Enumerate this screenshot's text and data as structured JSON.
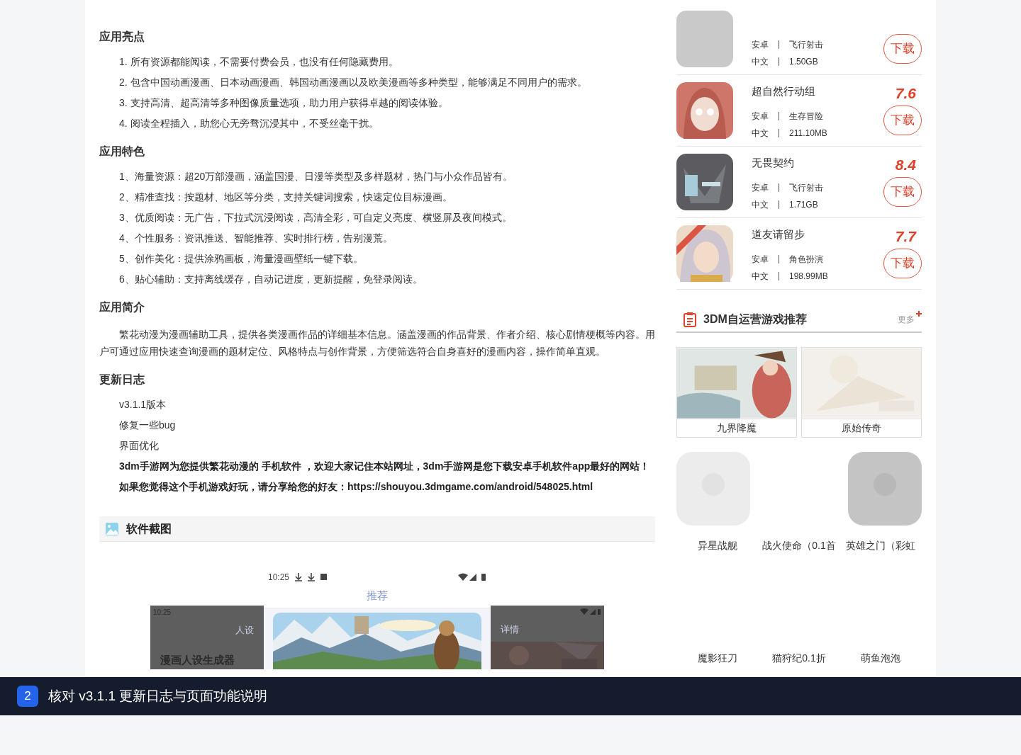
{
  "highlights": {
    "heading": "应用亮点",
    "items": [
      "1. 所有资源都能阅读，不需要付费会员，也没有任何隐藏费用。",
      "2. 包含中国动画漫画、日本动画漫画、韩国动画漫画以及欧美漫画等多种类型，能够满足不同用户的需求。",
      "3. 支持高清、超高清等多种图像质量选项，助力用户获得卓越的阅读体验。",
      "4. 阅读全程插入，助您心无旁骛沉浸其中，不受丝毫干扰。"
    ]
  },
  "features": {
    "heading": "应用特色",
    "items": [
      "1、海量资源：超20万部漫画，涵盖国漫、日漫等类型及多样题材，热门与小众作品皆有。",
      "2、精准查找：按题材、地区等分类，支持关键词搜索，快速定位目标漫画。",
      "3、优质阅读：无广告，下拉式沉浸阅读，高清全彩，可自定义亮度、横竖屏及夜间模式。",
      "4、个性服务：资讯推送、智能推荐、实时排行榜，告别漫荒。",
      "5、创作美化：提供涂鸦画板，海量漫画壁纸一键下载。",
      "6、贴心辅助：支持离线缓存，自动记进度，更新提醒，免登录阅读。"
    ]
  },
  "intro": {
    "heading": "应用简介",
    "text": "繁花动漫为漫画辅助工具，提供各类漫画作品的详细基本信息。涵盖漫画的作品背景、作者介绍、核心剧情梗概等内容。用户可通过应用快速查询漫画的题材定位、风格特点与创作背景，方便筛选符合自身喜好的漫画内容，操作简单直观。"
  },
  "changelog": {
    "heading": "更新日志",
    "lines": [
      "v3.1.1版本",
      "修复一些bug",
      "界面优化"
    ],
    "notes": [
      "3dm手游网为您提供繁花动漫的 手机软件 ，欢迎大家记住本站网址，3dm手游网是您下载安卓手机软件app最好的网站！",
      "如果您觉得这个手机游戏好玩，请分享给您的好友：https://shouyou.3dmgame.com/android/548025.html"
    ]
  },
  "screenshots": {
    "heading": "软件截图",
    "phones": [
      {
        "kind": "side",
        "time": "10:25",
        "title": "人设",
        "card": "漫画人设生成器"
      },
      {
        "kind": "main",
        "time": "10:25",
        "title": "推荐"
      },
      {
        "kind": "side",
        "title": "详情"
      }
    ]
  },
  "games": [
    {
      "platform": "安卓",
      "genre": "飞行射击",
      "language": "中文",
      "size": "1.50GB",
      "button": "下载"
    },
    {
      "name": "超自然行动组",
      "score": "7.6",
      "platform": "安卓",
      "genre": "生存冒险",
      "language": "中文",
      "size": "211.10MB",
      "button": "下载"
    },
    {
      "name": "无畏契约",
      "score": "8.4",
      "platform": "安卓",
      "genre": "飞行射击",
      "language": "中文",
      "size": "1.71GB",
      "button": "下载"
    },
    {
      "name": "道友请留步",
      "score": "7.7",
      "platform": "安卓",
      "genre": "角色扮演",
      "language": "中文",
      "size": "198.99MB",
      "button": "下载"
    }
  ],
  "recommend": {
    "title": "3DM自运营游戏推荐",
    "more": "更多",
    "banners": [
      {
        "name": "九界降魔"
      },
      {
        "name": "原始传奇"
      }
    ],
    "tiles": [
      {
        "name": "异星战舰",
        "kind": "picture"
      },
      {
        "name": "战火使命（0.1首"
      },
      {
        "name": "英雄之门（彩虹",
        "kind": "picture"
      },
      {
        "name": "魔影狂刀"
      },
      {
        "name": "猫狩纪0.1折"
      },
      {
        "name": "萌鱼泡泡"
      }
    ]
  },
  "caption": {
    "number": "2",
    "text": "核对 v3.1.1 更新日志与页面功能说明"
  }
}
